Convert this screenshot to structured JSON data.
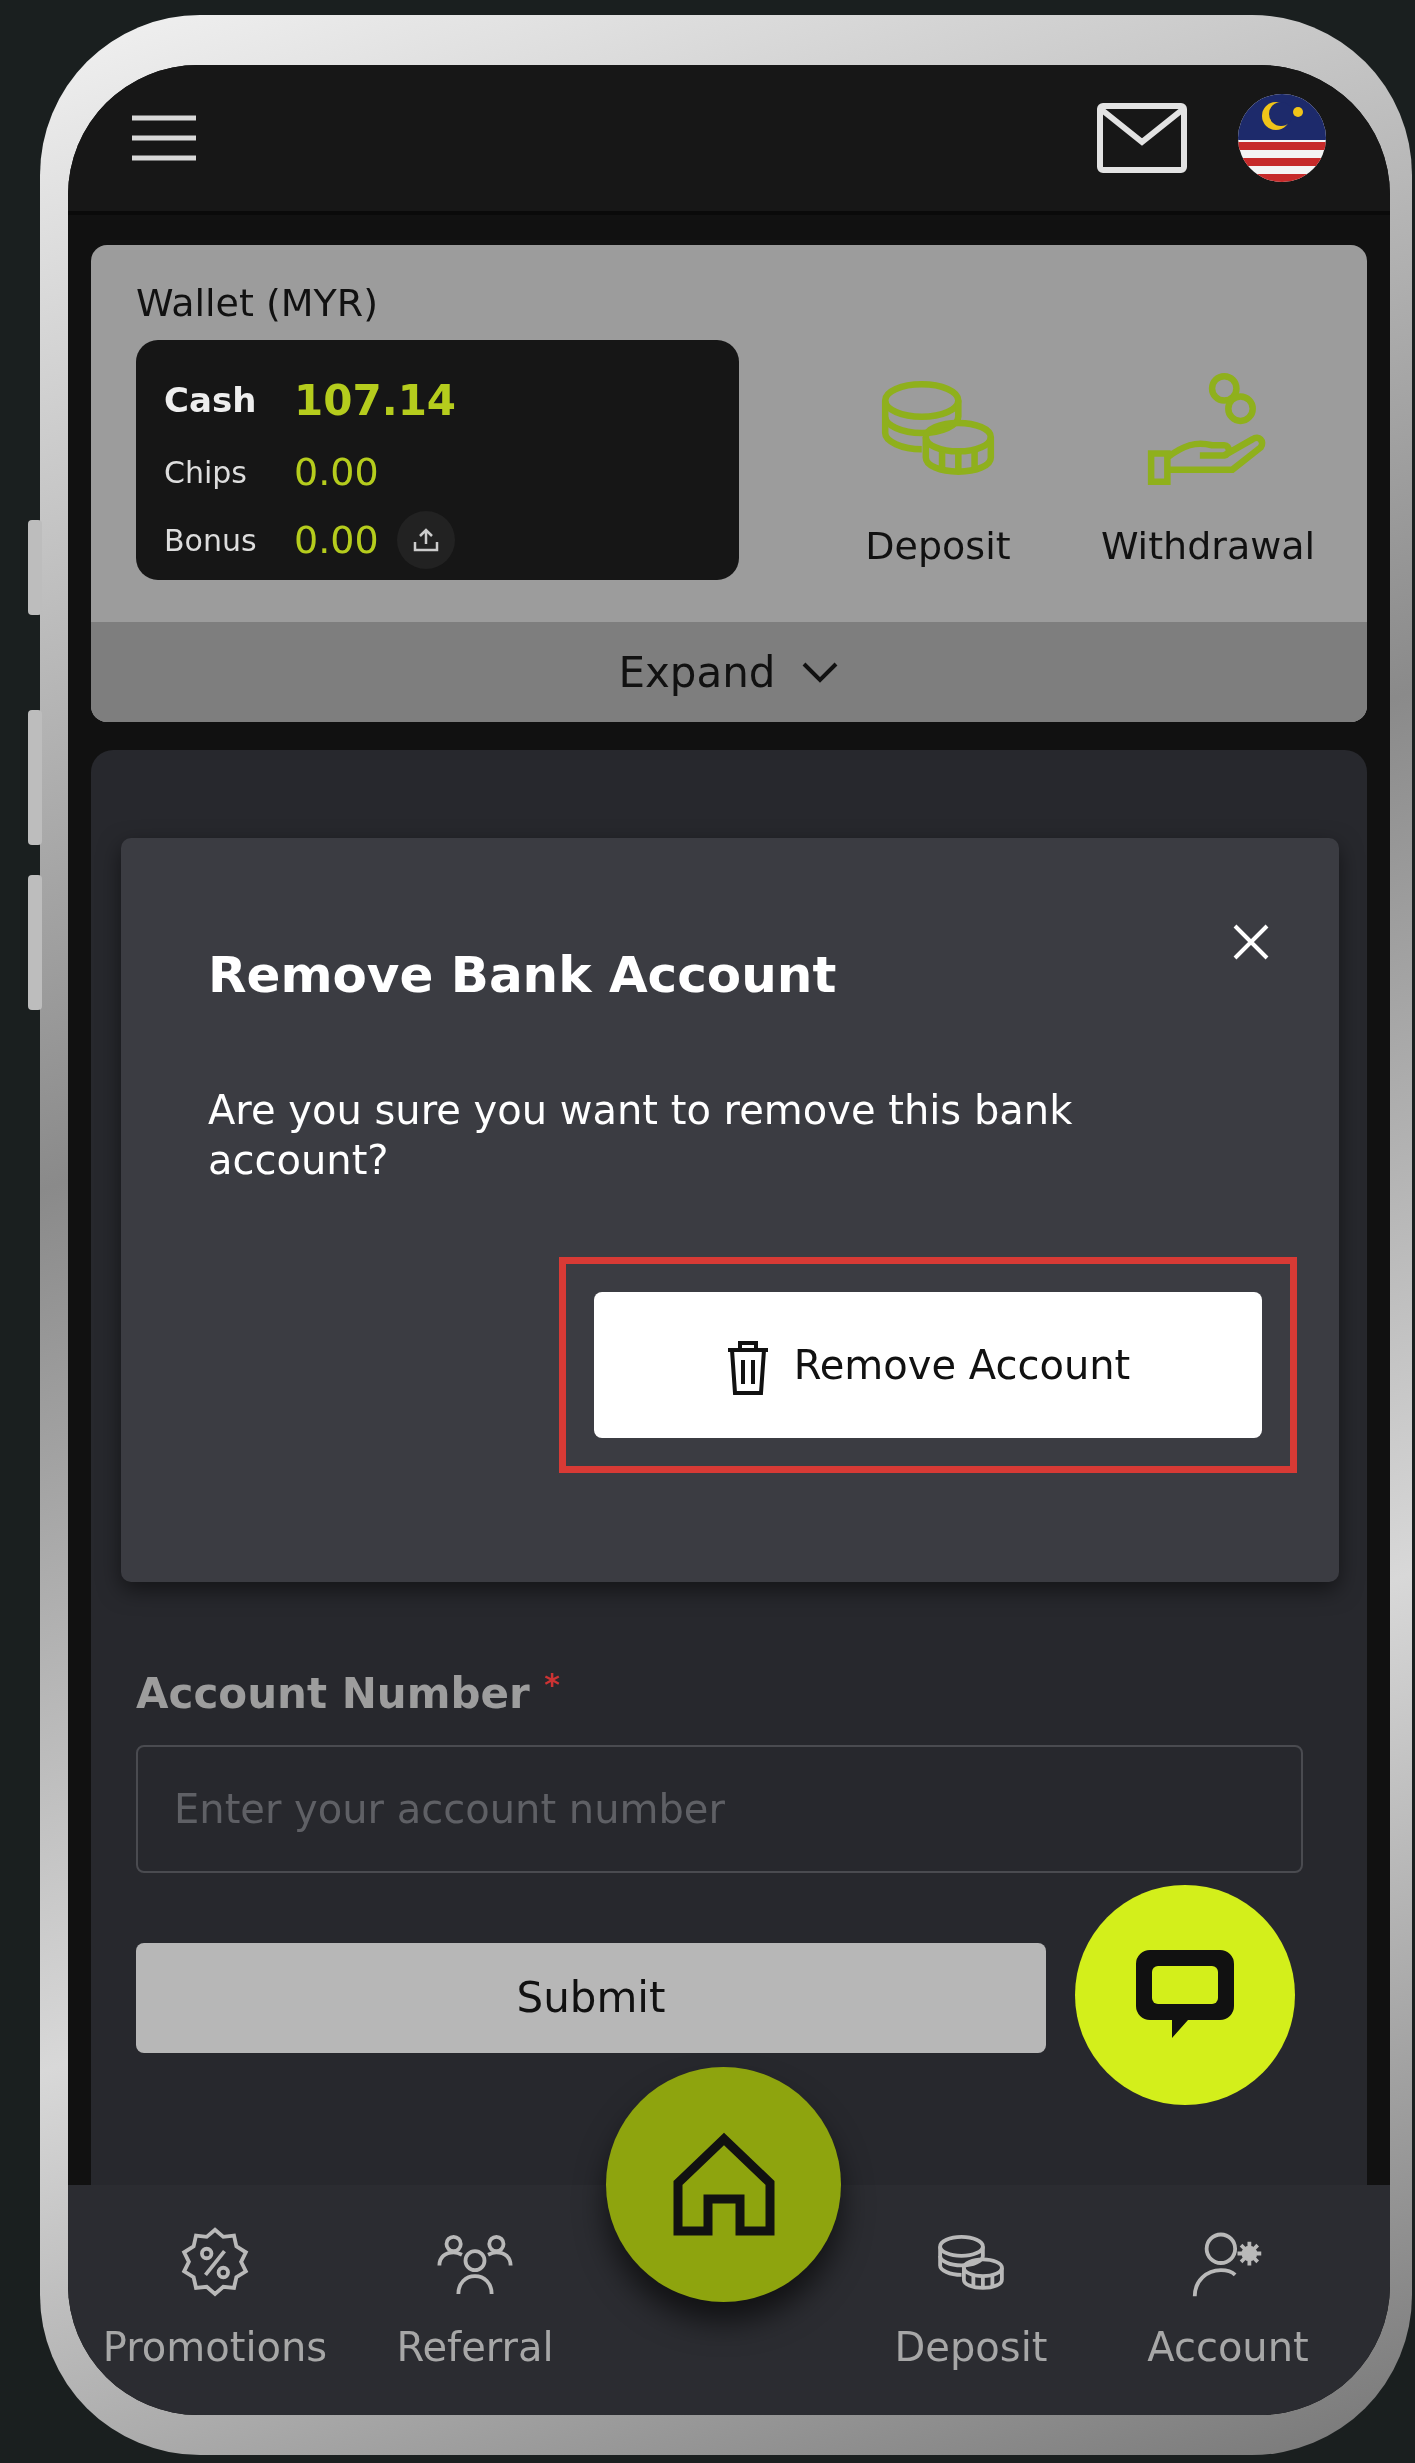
{
  "wallet": {
    "title": "Wallet (MYR)",
    "expand_label": "Expand",
    "balances": [
      {
        "label": "Cash",
        "value": "107.14",
        "emphasis": true,
        "transfer_button": false
      },
      {
        "label": "Chips",
        "value": "0.00",
        "emphasis": false,
        "transfer_button": false
      },
      {
        "label": "Bonus",
        "value": "0.00",
        "emphasis": false,
        "transfer_button": true
      }
    ],
    "actions": [
      {
        "label": "Deposit",
        "kind": "deposit"
      },
      {
        "label": "Withdrawal",
        "kind": "withdrawal"
      }
    ]
  },
  "dialog": {
    "title": "Remove Bank Account",
    "message": "Are you sure you want to remove this bank account?",
    "button": "Remove Account",
    "highlighted": true
  },
  "form": {
    "label": "Account Number",
    "required_mark": "*",
    "placeholder": "Enter your account number",
    "submit": "Submit"
  },
  "bottom_nav": [
    {
      "label": "Promotions",
      "kind": "promotions"
    },
    {
      "label": "Referral",
      "kind": "referral"
    },
    {
      "label": "Deposit",
      "kind": "deposit"
    },
    {
      "label": "Account",
      "kind": "account"
    }
  ]
}
